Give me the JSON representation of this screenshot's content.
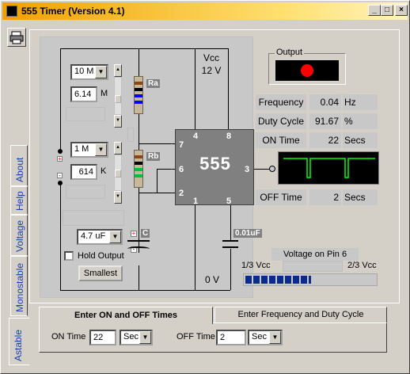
{
  "window": {
    "title": "555 Timer  (Version 4.1)",
    "min": "_",
    "max": "□",
    "close": "×"
  },
  "side_tabs": [
    "About",
    "Help",
    "Voltage",
    "Monostable",
    "Astable"
  ],
  "circuit": {
    "ra": {
      "value": "10 M",
      "mult": "6.14",
      "unit": "M",
      "label": "Ra"
    },
    "rb": {
      "value": "1 M",
      "mult": "614",
      "unit": "K",
      "label": "Rb"
    },
    "c": {
      "value": "4.7 uF",
      "label": "C"
    },
    "cap2": "0.01uF",
    "vcc_label": "Vcc",
    "vcc_value": "12 V",
    "zero_v": "0 V",
    "chip": "555",
    "pins": {
      "p4": "4",
      "p8": "8",
      "p7": "7",
      "p6": "6",
      "p3": "3",
      "p2": "2",
      "p1": "1",
      "p5": "5"
    },
    "hold_output": "Hold Output",
    "smallest": "Smallest"
  },
  "output": {
    "label": "Output",
    "color_on": "#ff0000"
  },
  "stats": {
    "frequency_label": "Frequency",
    "frequency_value": "0.04",
    "frequency_unit": "Hz",
    "duty_label": "Duty Cycle",
    "duty_value": "91.67",
    "duty_unit": "%",
    "on_label": "ON Time",
    "on_value": "22",
    "on_unit": "Secs",
    "off_label": "OFF Time",
    "off_value": "2",
    "off_unit": "Secs"
  },
  "voltage": {
    "title": "Voltage on Pin 6",
    "low": "1/3 Vcc",
    "high": "2/3 Vcc",
    "level": 0.5
  },
  "tabs": {
    "active": "Enter ON and OFF Times",
    "inactive": "Enter Frequency and Duty Cycle"
  },
  "inputs": {
    "on_label": "ON Time",
    "on_value": "22",
    "on_unit": "Sec",
    "off_label": "OFF Time",
    "off_value": "2",
    "off_unit": "Sec"
  }
}
